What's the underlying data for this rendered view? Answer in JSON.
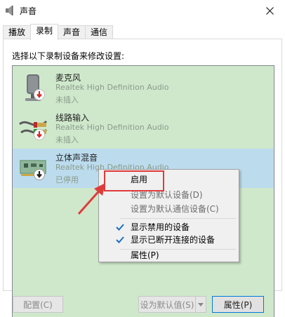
{
  "window": {
    "title": "声音"
  },
  "tabs": [
    {
      "label": "播放",
      "active": false
    },
    {
      "label": "录制",
      "active": true
    },
    {
      "label": "声音",
      "active": false
    },
    {
      "label": "通信",
      "active": false
    }
  ],
  "panel": {
    "instruction": "选择以下录制设备来修改设置:"
  },
  "devices": [
    {
      "name": "麦克风",
      "driver": "Realtek High Definition Audio",
      "status": "未插入",
      "icon": "microphone-icon",
      "badge": "unplugged-badge-icon",
      "selected": false
    },
    {
      "name": "线路输入",
      "driver": "Realtek High Definition Audio",
      "status": "未插入",
      "icon": "line-in-cable-icon",
      "badge": "unplugged-badge-icon",
      "selected": false
    },
    {
      "name": "立体声混音",
      "driver": "Realtek High Definition Audio",
      "status": "已停用",
      "icon": "sound-card-icon",
      "badge": "disabled-badge-icon",
      "selected": true
    }
  ],
  "context_menu": {
    "items": [
      {
        "label": "启用",
        "enabled": true,
        "checked": false
      },
      {
        "label": "设置为默认设备(D)",
        "enabled": false,
        "checked": false
      },
      {
        "label": "设置为默认通信设备(C)",
        "enabled": false,
        "checked": false
      },
      {
        "label": "显示禁用的设备",
        "enabled": true,
        "checked": true
      },
      {
        "label": "显示已断开连接的设备",
        "enabled": true,
        "checked": true
      },
      {
        "label": "属性(P)",
        "enabled": true,
        "checked": false
      }
    ]
  },
  "buttons": {
    "configure": "配置(C)",
    "set_default": "设为默认值(S)",
    "properties": "属性(P)"
  },
  "colors": {
    "list_bg": "#cfe8cc",
    "selected_bg": "#bcdcee",
    "highlight": "#e03b3b",
    "check": "#1a6fc4"
  }
}
